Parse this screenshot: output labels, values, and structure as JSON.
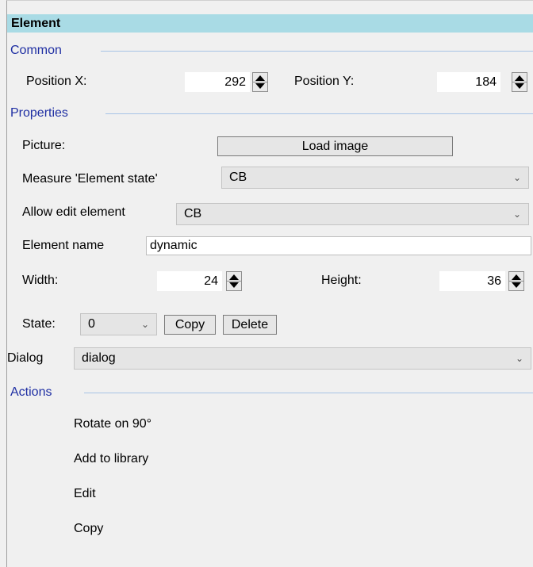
{
  "panel": {
    "title": "Element"
  },
  "common": {
    "section_label": "Common",
    "position_x_label": "Position X:",
    "position_x_value": "292",
    "position_y_label": "Position Y:",
    "position_y_value": "184"
  },
  "properties": {
    "section_label": "Properties",
    "picture_label": "Picture:",
    "load_image_label": "Load image",
    "measure_label": "Measure 'Element state'",
    "measure_value": "CB",
    "allow_edit_label": "Allow edit element",
    "allow_edit_value": "CB",
    "element_name_label": "Element name",
    "element_name_value": "dynamic",
    "width_label": "Width:",
    "width_value": "24",
    "height_label": "Height:",
    "height_value": "36",
    "state_label": "State:",
    "state_value": "0",
    "copy_label": "Copy",
    "delete_label": "Delete",
    "dialog_label": "Dialog",
    "dialog_value": "dialog"
  },
  "actions": {
    "section_label": "Actions",
    "items": [
      "Rotate on 90°",
      "Add to library",
      "Edit",
      "Copy"
    ]
  },
  "colors": {
    "title_bar": "#a9dbe5",
    "section_text": "#1f2fa3",
    "section_line": "#a7c4e6"
  }
}
